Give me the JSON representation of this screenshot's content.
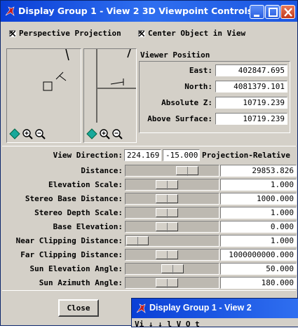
{
  "window": {
    "title": "Display Group 1 - View 2 3D Viewpoint Controls"
  },
  "options": {
    "perspective_label": "Perspective Projection",
    "center_object_label": "Center Object in View"
  },
  "viewer_position": {
    "heading": "Viewer Position",
    "fields": [
      {
        "label": "East:",
        "value": "402847.695"
      },
      {
        "label": "North:",
        "value": "4081379.101"
      },
      {
        "label": "Absolute Z:",
        "value": "10719.239"
      },
      {
        "label": "Above Surface:",
        "value": "10719.239"
      }
    ]
  },
  "view_direction": {
    "label": "View Direction:",
    "azimuth": "224.169",
    "elevation": "-15.000",
    "mode": "Projection-Relative"
  },
  "sliders": [
    {
      "label": "Distance:",
      "value": "29853.826",
      "level": 0.72
    },
    {
      "label": "Elevation Scale:",
      "value": "1.000",
      "level": 0.42
    },
    {
      "label": "Stereo Base Distance:",
      "value": "1000.000",
      "level": 0.42
    },
    {
      "label": "Stereo Depth Scale:",
      "value": "1.000",
      "level": 0.42
    },
    {
      "label": "Base Elevation:",
      "value": "0.000",
      "level": 0.42
    },
    {
      "label": "Near Clipping Distance:",
      "value": "1.000",
      "level": 0.0
    },
    {
      "label": "Far Clipping Distance:",
      "value": "1000000000.000",
      "level": 0.42
    },
    {
      "label": "Sun Elevation Angle:",
      "value": "50.000",
      "level": 0.5
    },
    {
      "label": "Sun Azimuth Angle:",
      "value": "180.000",
      "level": 0.42
    }
  ],
  "buttons": {
    "close_label": "Close"
  },
  "second_window": {
    "title": "Display Group 1 - View 2",
    "fragment": "Vi   ↓  ↓ l   V  O t"
  },
  "colors": {
    "titlebar": "#2f6ff0",
    "dialog_bg": "#d4d0c8",
    "slider_track": "#bdb9b1"
  }
}
